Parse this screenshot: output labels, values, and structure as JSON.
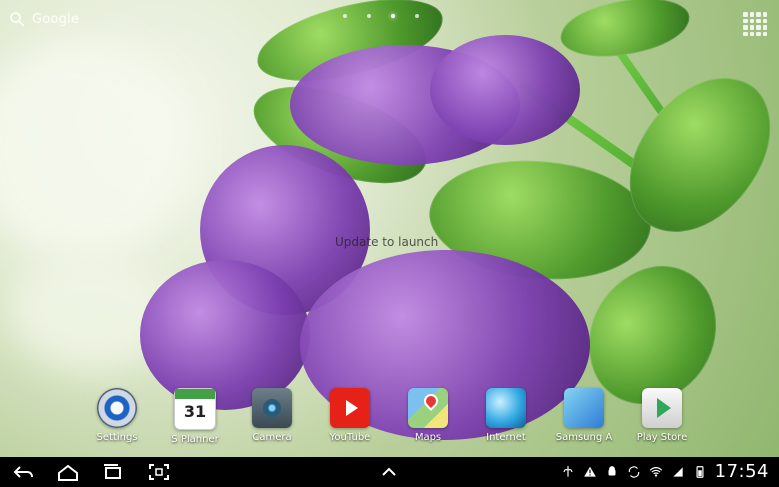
{
  "search": {
    "label": "Google"
  },
  "center_message": "Update to launch",
  "apps": [
    {
      "label": "Settings",
      "icon": "settings-icon"
    },
    {
      "label": "S Planner",
      "icon": "calendar-icon",
      "date": "31"
    },
    {
      "label": "Camera",
      "icon": "camera-icon"
    },
    {
      "label": "YouTube",
      "icon": "youtube-icon"
    },
    {
      "label": "Maps",
      "icon": "maps-icon"
    },
    {
      "label": "Internet",
      "icon": "globe-icon"
    },
    {
      "label": "Samsung A",
      "icon": "samsung-apps-icon"
    },
    {
      "label": "Play Store",
      "icon": "play-store-icon"
    }
  ],
  "status_bar": {
    "time": "17:54",
    "icons": [
      "usb-icon",
      "warning-icon",
      "android-icon",
      "sync-icon",
      "wifi-icon",
      "signal-icon",
      "battery-icon"
    ]
  },
  "navigation": [
    "back-icon",
    "home-icon",
    "recent-apps-icon",
    "screenshot-icon",
    "up-arrow-icon"
  ],
  "colors": {
    "background": "#b9cf9b",
    "leaf": "#4f9a2c",
    "flower": "#7c3fb0",
    "navbar": "#000000",
    "status_text": "#ffffff"
  }
}
